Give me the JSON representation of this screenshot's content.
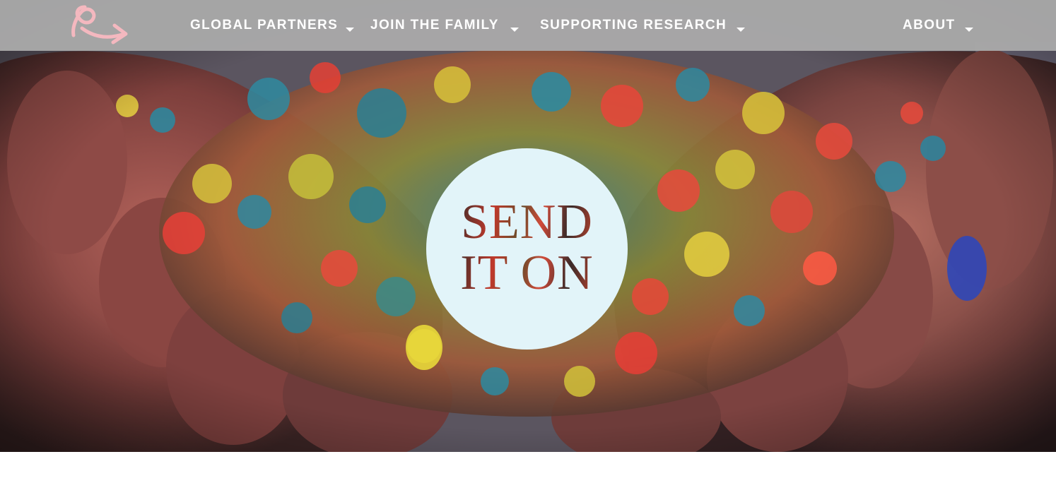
{
  "nav": {
    "items": [
      {
        "label": "GLOBAL PARTNERS"
      },
      {
        "label": "JOIN THE FAMILY"
      },
      {
        "label": "SUPPORTING RESEARCH"
      },
      {
        "label": "ABOUT"
      }
    ],
    "caret_icon": "caret-down-icon",
    "text_color": "#ffffff",
    "bar_color": "#a8a8a8"
  },
  "logo": {
    "icon": "ribbon-arrow-icon",
    "color": "#f4b8bf"
  },
  "hero": {
    "image": "hands-holding-colored-powder",
    "badge": {
      "line1": "SEND",
      "line2": "IT ON",
      "background": "#e2f4f9"
    }
  }
}
